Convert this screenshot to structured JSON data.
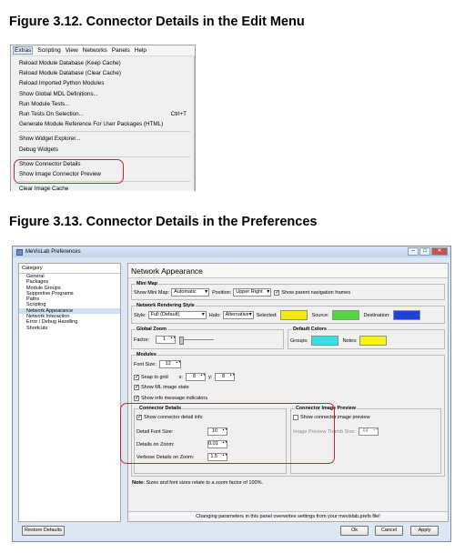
{
  "figure1": {
    "title": "Figure 3.12. Connector Details in the Edit Menu",
    "menubar": [
      "Extras",
      "Scripting",
      "View",
      "Networks",
      "Panels",
      "Help"
    ],
    "items_group1": [
      "Reload Module Database (Keep Cache)",
      "Reload Module Database (Clear Cache)",
      "Reload Imported Python Modules",
      "Show Global MDL Definitions...",
      "Run Module Tests...",
      "Run Tests On Selection..."
    ],
    "run_tests_shortcut": "Ctrl+T",
    "generate_item": "Generate Module Reference For User Packages (HTML)",
    "items_group2": [
      "Show Widget Explorer...",
      "Debug Widgets"
    ],
    "show_connector_details": "Show Connector Details",
    "show_image_connector_preview": "Show Image Connector Preview",
    "clear_image_cache": "Clear Image Cache"
  },
  "figure2": {
    "title": "Figure 3.13. Connector Details in the Preferences",
    "window_title": "MeVisLab Preferences",
    "category_header": "Category",
    "categories": [
      "General",
      "Packages",
      "Module Groups",
      "Supportive Programs",
      "Paths",
      "Scripting",
      "Network Appearance",
      "Network Interaction",
      "Error / Debug Handling",
      "Shortcuts"
    ],
    "selected_category": "Network Appearance",
    "panel_title": "Network Appearance",
    "minimap": {
      "group": "Mini Map",
      "show_label": "Show Mini Map:",
      "show_value": "Automatic",
      "position_label": "Position:",
      "position_value": "Upper Right",
      "parent_nav": "Show parent navigation frames"
    },
    "rendering": {
      "group": "Network Rendering Style",
      "style_label": "Style:",
      "style_value": "Full (Default)",
      "halo_label": "Halo:",
      "halo_value": "Alternative",
      "selected_label": "Selected:",
      "source_label": "Source:",
      "destination_label": "Destination:"
    },
    "global_zoom": {
      "group": "Global Zoom",
      "factor_label": "Factor:",
      "factor_value": "1"
    },
    "default_colors": {
      "group": "Default Colors",
      "groups_label": "Groups:",
      "notes_label": "Notes:"
    },
    "modules": {
      "group": "Modules",
      "font_size_label": "Font Size:",
      "font_size_value": "12",
      "snap_label": "Snap to grid",
      "x_label": "x:",
      "x_value": "8",
      "y_label": "y:",
      "y_value": "8",
      "ml_image_state": "Show ML image state",
      "info_indicators": "Show info message indicators"
    },
    "connector_details": {
      "group": "Connector Details",
      "show_info": "Show connector detail info",
      "detail_font_label": "Detail Font Size:",
      "detail_font_value": "10",
      "details_zoom_label": "Details on Zoom:",
      "details_zoom_value": "0.01",
      "verbose_label": "Verbose Details on Zoom:",
      "verbose_value": "1.5"
    },
    "connector_preview": {
      "group": "Connector Image Preview",
      "show_preview": "Show connector image preview",
      "thumb_label": "Image Preview Thumb Size:",
      "thumb_value": "64"
    },
    "note_prefix": "Note:",
    "note_text": "Sizes and font sizes relate to a zoom factor of 100%.",
    "status": "Changing parameters in this panel overwrites settings from your mevislab.prefs file!",
    "buttons": {
      "restore": "Restore Defaults",
      "ok": "Ok",
      "cancel": "Cancel",
      "apply": "Apply"
    },
    "colors": {
      "selected": "#f5e60f",
      "source": "#4fd83a",
      "destination": "#1d43d6",
      "groups": "#33e0e6",
      "notes": "#f5f21e"
    }
  }
}
